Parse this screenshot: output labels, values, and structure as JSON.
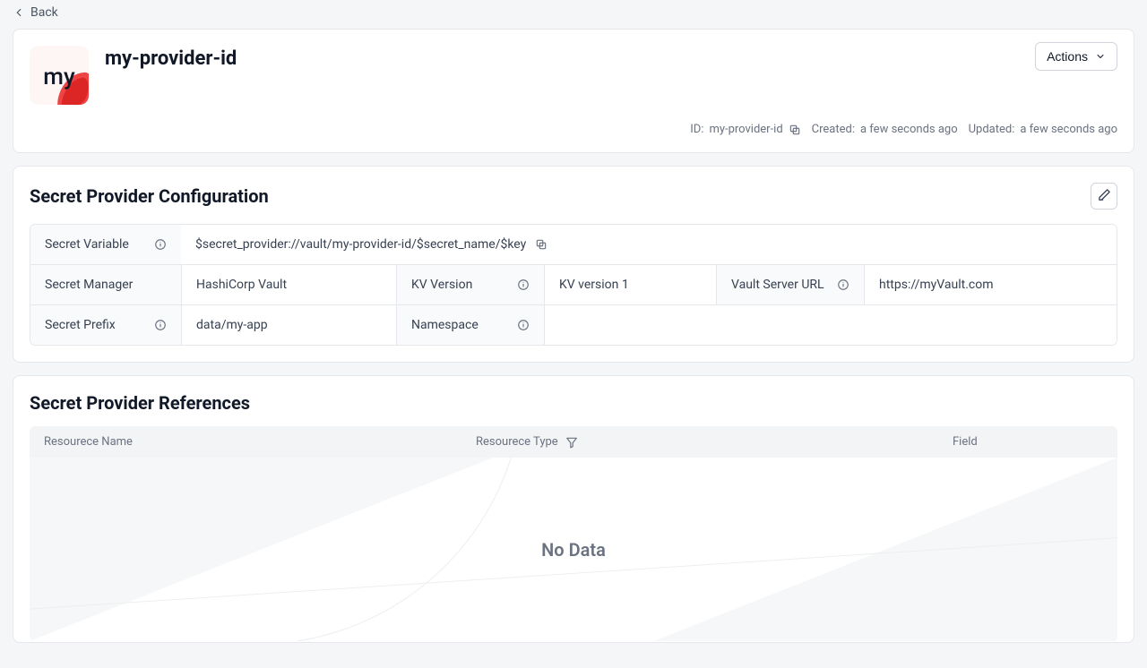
{
  "back": {
    "label": "Back"
  },
  "header": {
    "logo_text": "my",
    "title": "my-provider-id",
    "actions_label": "Actions",
    "id_label": "ID:",
    "id_value": "my-provider-id",
    "created_label": "Created:",
    "created_value": "a few seconds ago",
    "updated_label": "Updated:",
    "updated_value": "a few seconds ago"
  },
  "config": {
    "section_title": "Secret Provider Configuration",
    "secret_variable": {
      "label": "Secret Variable",
      "value": "$secret_provider://vault/my-provider-id/$secret_name/$key"
    },
    "secret_manager": {
      "label": "Secret Manager",
      "value": "HashiCorp Vault"
    },
    "kv_version": {
      "label": "KV Version",
      "value": "KV version 1"
    },
    "vault_url": {
      "label": "Vault Server URL",
      "value": "https://myVault.com"
    },
    "secret_prefix": {
      "label": "Secret Prefix",
      "value": "data/my-app"
    },
    "namespace": {
      "label": "Namespace",
      "value": ""
    }
  },
  "references": {
    "section_title": "Secret Provider References",
    "columns": {
      "name": "Resourece Name",
      "type": "Resourece Type",
      "field": "Field"
    },
    "empty_text": "No Data"
  }
}
